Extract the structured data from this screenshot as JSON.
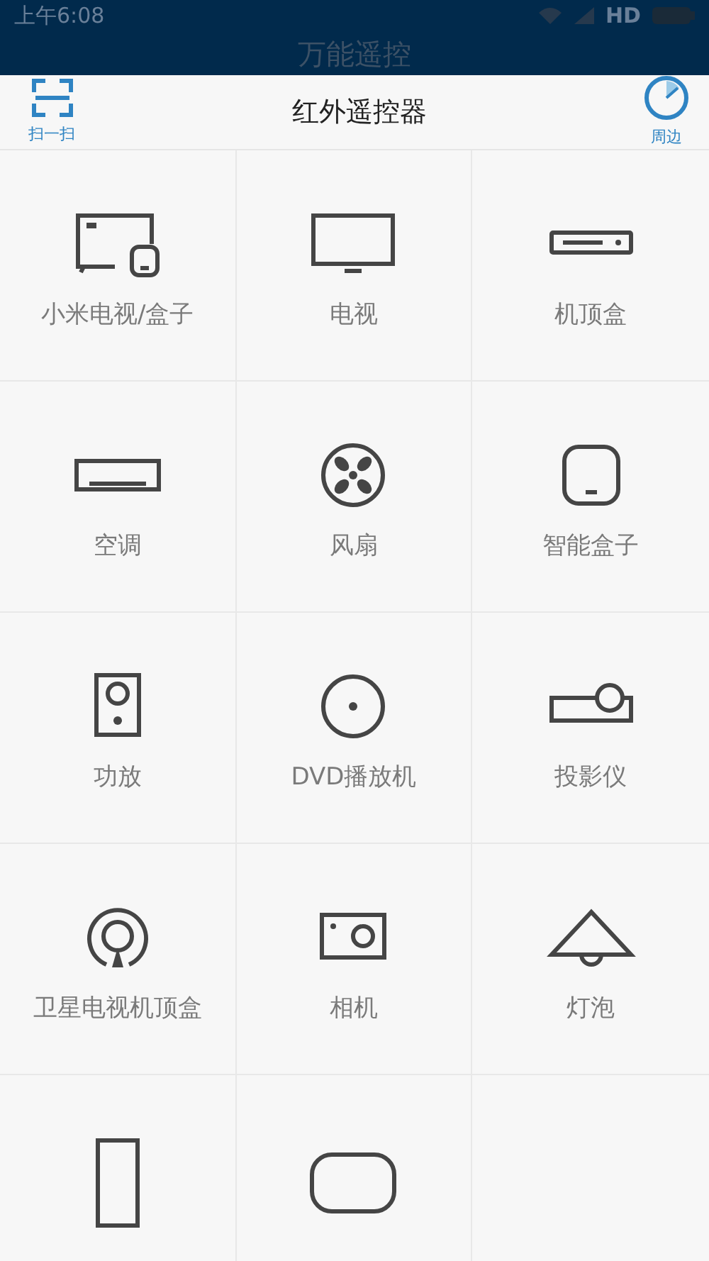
{
  "status_bar": {
    "time": "上午6:08",
    "network": "HD"
  },
  "app_bar": {
    "title": "万能遥控"
  },
  "toolbar": {
    "left": {
      "label": "扫一扫"
    },
    "title": "红外遥控器",
    "right": {
      "label": "周边"
    }
  },
  "devices": [
    {
      "kind": "mi-tv-box",
      "label": "小米电视/盒子"
    },
    {
      "kind": "tv",
      "label": "电视"
    },
    {
      "kind": "set-top-box",
      "label": "机顶盒"
    },
    {
      "kind": "air-conditioner",
      "label": "空调"
    },
    {
      "kind": "fan",
      "label": "风扇"
    },
    {
      "kind": "smart-box",
      "label": "智能盒子"
    },
    {
      "kind": "amplifier",
      "label": "功放"
    },
    {
      "kind": "dvd",
      "label": "DVD播放机"
    },
    {
      "kind": "projector",
      "label": "投影仪"
    },
    {
      "kind": "satellite",
      "label": "卫星电视机顶盒"
    },
    {
      "kind": "camera",
      "label": "相机"
    },
    {
      "kind": "lamp",
      "label": "灯泡"
    },
    {
      "kind": "tall-device"
    },
    {
      "kind": "rounded-device"
    }
  ]
}
